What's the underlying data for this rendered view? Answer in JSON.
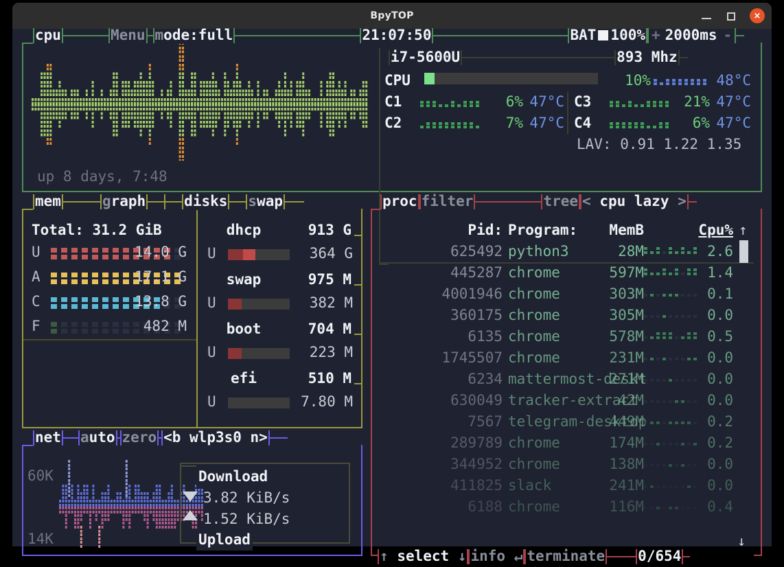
{
  "window": {
    "title": "BpyTOP",
    "buttons": {
      "minimize": "minimize-icon",
      "maximize": "maximize-icon",
      "close": "×"
    }
  },
  "colors": {
    "background": "#1f2230",
    "titlebar": "#2e2e2e",
    "cpu_border": "#4f8c58",
    "mem_border": "#9a9a3c",
    "net_border": "#6b5ce7",
    "proc_border": "#a8414a",
    "green": "#6ecf7b",
    "blue": "#6f93e8",
    "grey": "#8a8f9c",
    "white": "#f0f2f6",
    "close_button": "#e8542a"
  },
  "cpu_panel": {
    "title": "cpu",
    "menu": "Menu",
    "menu_key": "M",
    "mode": "mode:full",
    "mode_key": "m",
    "clock": "21:07:50",
    "battery_label": "BAT",
    "battery_icon": "battery-full-icon",
    "battery_percent": "100%",
    "timer_plus": "+",
    "timer_value": "2000ms",
    "timer_minus": "-",
    "uptime": "up 8 days, 7:48",
    "cpu_name": "i7-5600U",
    "frequency": "893 Mhz",
    "total": {
      "label": "CPU",
      "percent": "10%",
      "temp": "48°C",
      "bar_fill_pct": 10
    },
    "cores": [
      {
        "label": "C1",
        "percent": "6%",
        "temp": "47°C"
      },
      {
        "label": "C2",
        "percent": "7%",
        "temp": "47°C"
      },
      {
        "label": "C3",
        "percent": "21%",
        "temp": "47°C"
      },
      {
        "label": "C4",
        "percent": "6%",
        "temp": "47°C"
      }
    ],
    "load_avg_label": "LAV:",
    "load_avg": "0.91 1.22 1.35"
  },
  "mem_panel": {
    "title": "mem",
    "graph_tab": "graph",
    "graph_key": "g",
    "disks_tab": "disks",
    "swap_tab": "swap",
    "swap_key": "s",
    "total_label": "Total:",
    "total_value": "31.2 GiB",
    "rows": [
      {
        "key": "U",
        "value": "14.0 G",
        "color": "#c25a5a",
        "fill": 45
      },
      {
        "key": "A",
        "value": "17.1 G",
        "color": "#e8c15a",
        "fill": 55
      },
      {
        "key": "C",
        "value": "13.8 G",
        "color": "#5ab9d4",
        "fill": 44
      },
      {
        "key": "F",
        "value": "482 M",
        "color": "#3c5a44",
        "fill": 2
      }
    ],
    "disks": [
      {
        "name": "dhcp",
        "size": "913 G",
        "used_key": "U",
        "used": "364 G",
        "fill": 40
      },
      {
        "name": "swap",
        "size": "975 M",
        "used_key": "U",
        "used": "382 M",
        "fill": 22
      },
      {
        "name": "boot",
        "size": "704 M",
        "used_key": "U",
        "used": "223 M",
        "fill": 22
      },
      {
        "name": "efi",
        "size": "510 M",
        "used_key": "U",
        "used": "7.80 M",
        "fill": 2
      }
    ]
  },
  "net_panel": {
    "title": "net",
    "auto_tab": "auto",
    "auto_key": "a",
    "zero_tab": "zero",
    "zero_key": "z",
    "device": "<b wlp3s0 n>",
    "scale_top": "60K",
    "scale_bottom": "14K",
    "download_label": "Download",
    "download_value": "3.82 KiB/s",
    "download_icon": "arrow-down-icon",
    "upload_label": "Upload",
    "upload_value": "1.52 KiB/s",
    "upload_icon": "arrow-up-icon"
  },
  "proc_panel": {
    "title": "proc",
    "filter_tab": "filter",
    "filter_key": "f",
    "tree_tab": "tree",
    "tree_key": "t",
    "sort_left": "<",
    "sort_label": "cpu lazy",
    "sort_right": ">",
    "headers": {
      "pid": "Pid:",
      "program": "Program:",
      "mem": "MemB",
      "cpu": "Cpu%",
      "sort_arrow": "↑"
    },
    "rows": [
      {
        "pid": "625492",
        "program": "python3",
        "mem": "28M",
        "cpu": "2.6",
        "graph": 8,
        "dim": 0
      },
      {
        "pid": "445287",
        "program": "chrome",
        "mem": "597M",
        "cpu": "1.4",
        "graph": 8,
        "dim": 1
      },
      {
        "pid": "4001946",
        "program": "chrome",
        "mem": "303M",
        "cpu": "0.1",
        "graph": 4,
        "dim": 2
      },
      {
        "pid": "360175",
        "program": "chrome",
        "mem": "305M",
        "cpu": "0.0",
        "graph": 4,
        "dim": 2
      },
      {
        "pid": "6135",
        "program": "chrome",
        "mem": "578M",
        "cpu": "0.5",
        "graph": 7,
        "dim": 3
      },
      {
        "pid": "1745507",
        "program": "chrome",
        "mem": "231M",
        "cpu": "0.0",
        "graph": 4,
        "dim": 4
      },
      {
        "pid": "6234",
        "program": "mattermost-deskt",
        "mem": "271M",
        "cpu": "0.0",
        "graph": 4,
        "dim": 5
      },
      {
        "pid": "630049",
        "program": "tracker-extract",
        "mem": "42M",
        "cpu": "0.0",
        "graph": 4,
        "dim": 6
      },
      {
        "pid": "7567",
        "program": "telegram-desktop",
        "mem": "449M",
        "cpu": "0.2",
        "graph": 4,
        "dim": 7
      },
      {
        "pid": "289789",
        "program": "chrome",
        "mem": "174M",
        "cpu": "0.2",
        "graph": 4,
        "dim": 8
      },
      {
        "pid": "344952",
        "program": "chrome",
        "mem": "138M",
        "cpu": "0.0",
        "graph": 4,
        "dim": 9
      },
      {
        "pid": "411825",
        "program": "slack",
        "mem": "241M",
        "cpu": "0.0",
        "graph": 4,
        "dim": 10
      },
      {
        "pid": "6188",
        "program": "chrome",
        "mem": "116M",
        "cpu": "0.4",
        "graph": 4,
        "dim": 11
      }
    ],
    "scroll_up_icon": "↑",
    "scroll_down_icon": "↓",
    "status": {
      "select_left": "↑",
      "select_label": "select",
      "select_right": "↓",
      "info_label": "info",
      "info_icon": "↵",
      "terminate_label": "terminate",
      "counter": "0/654"
    }
  }
}
